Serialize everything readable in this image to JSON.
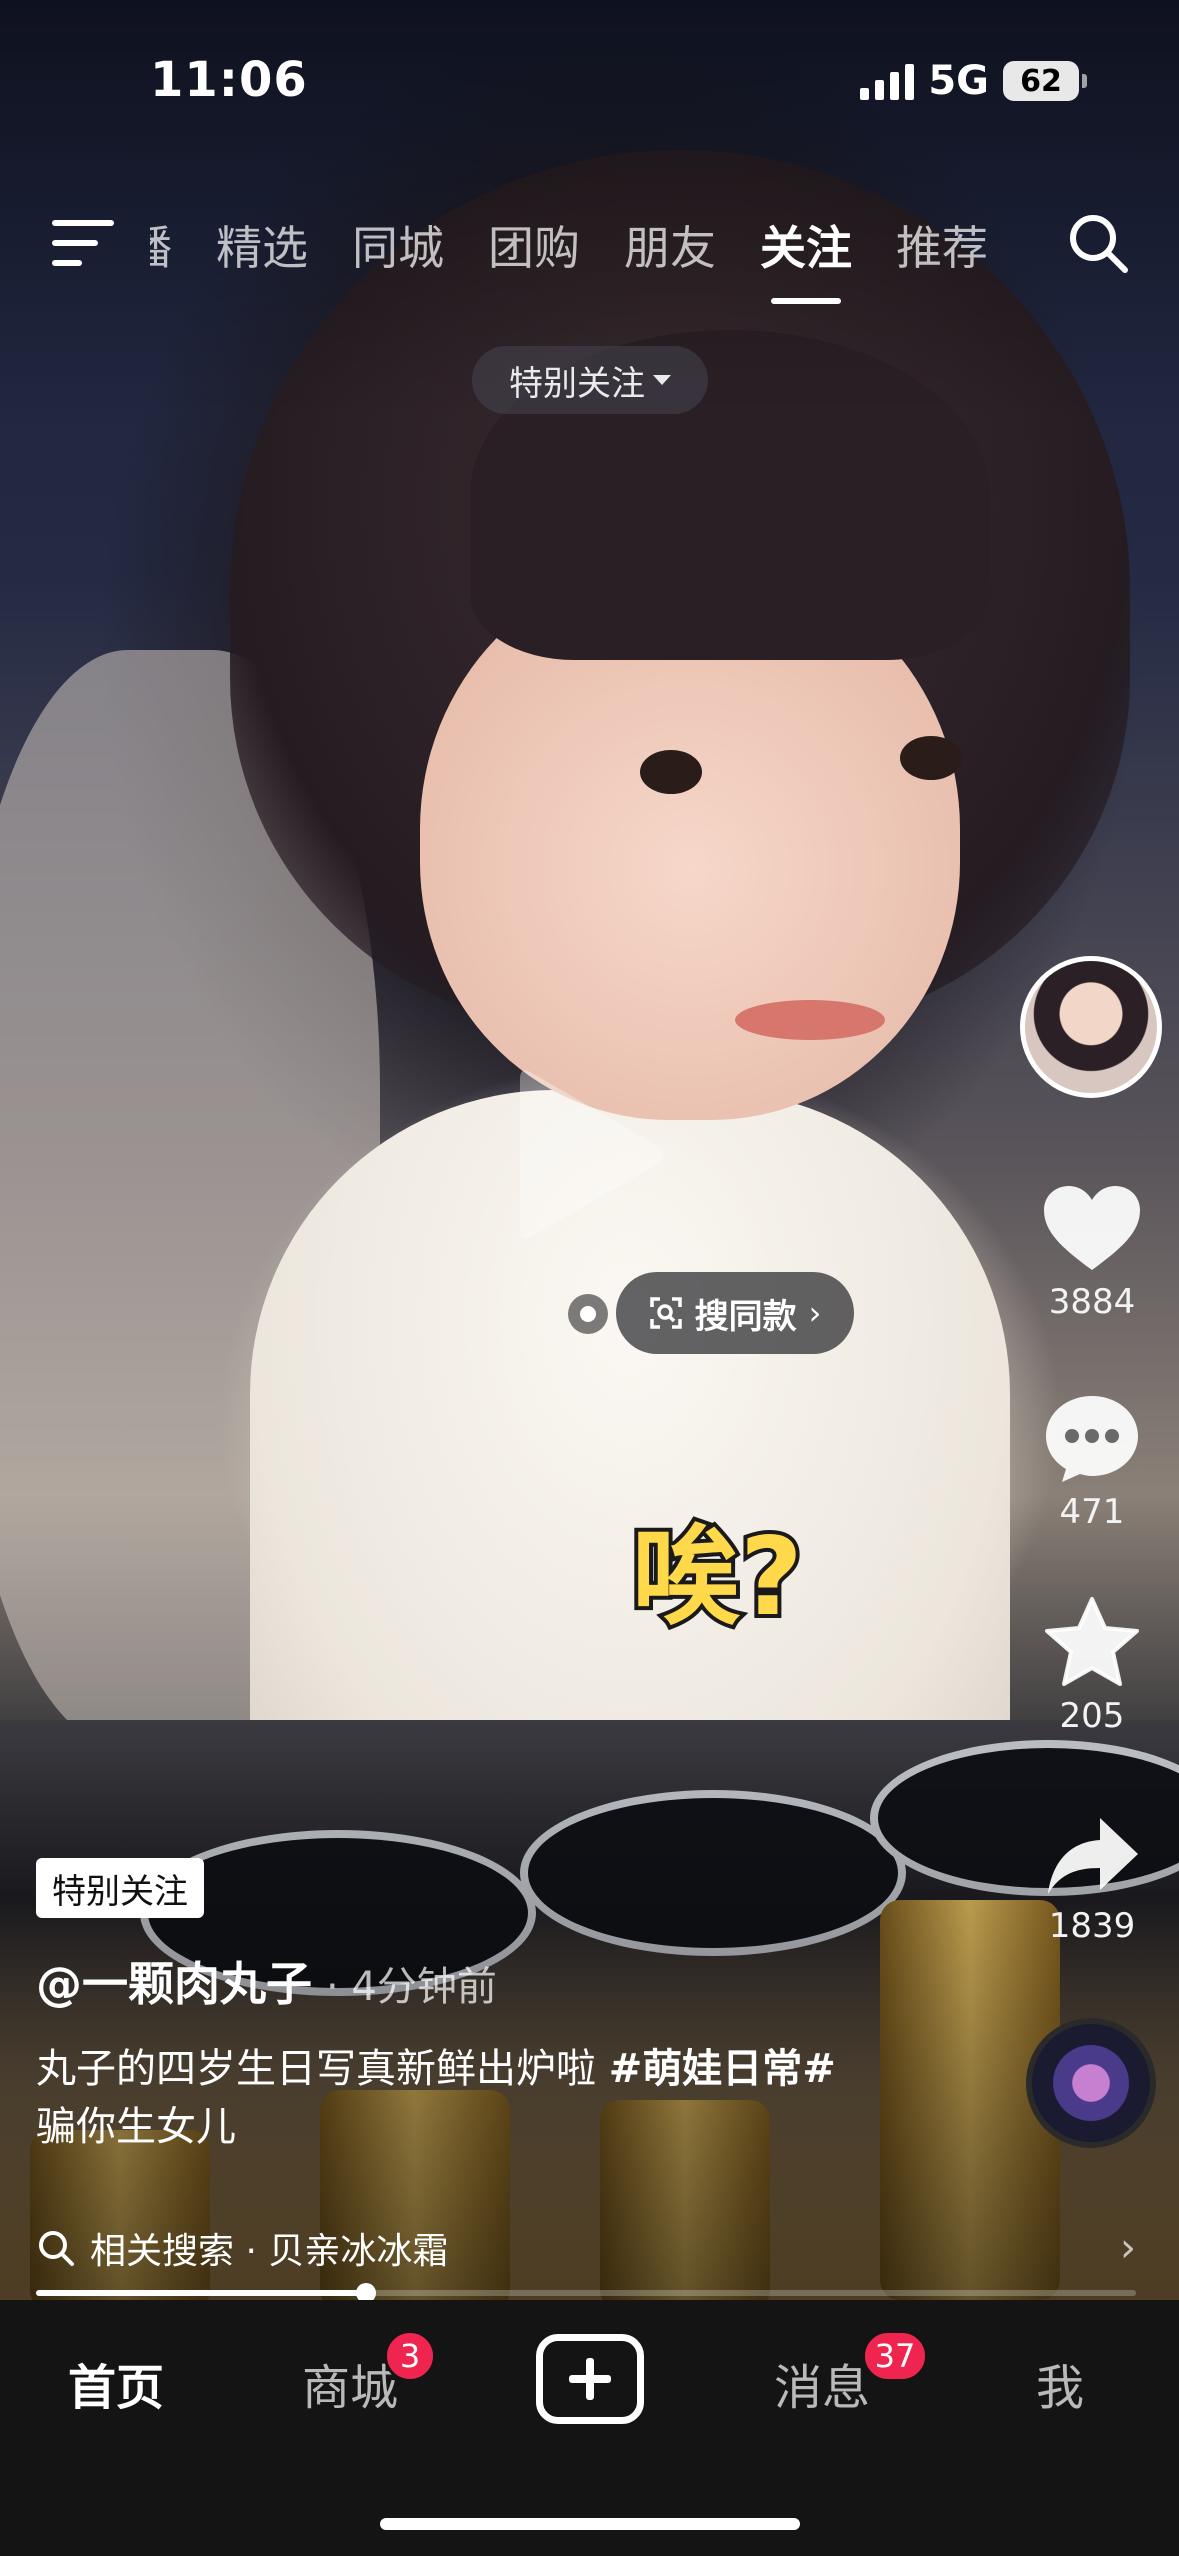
{
  "status_bar": {
    "time": "11:06",
    "network": "5G",
    "battery": "62"
  },
  "top_nav": {
    "tabs": [
      {
        "label": "播",
        "active": false
      },
      {
        "label": "精选",
        "active": false
      },
      {
        "label": "同城",
        "active": false
      },
      {
        "label": "团购",
        "active": false
      },
      {
        "label": "朋友",
        "active": false
      },
      {
        "label": "关注",
        "active": true
      },
      {
        "label": "推荐",
        "active": false
      }
    ],
    "special_follow_pill": "特别关注"
  },
  "video_overlay": {
    "search_same_label": "搜同款",
    "sticker_text": "唉?"
  },
  "right_rail": {
    "like_count": "3884",
    "comment_count": "471",
    "favorite_count": "205",
    "share_count": "1839"
  },
  "caption": {
    "tag": "特别关注",
    "author": "@一颗肉丸子",
    "time_ago": "· 4分钟前",
    "text": "丸子的四岁生日写真新鲜出炉啦 ",
    "hashtag": "#萌娃日常#",
    "text_line2": "骗你生女儿"
  },
  "related_search": {
    "label": "相关搜索 · 贝亲冰冰霜"
  },
  "playback": {
    "progress": 0.3
  },
  "bottom_nav": {
    "home": "首页",
    "mall": "商城",
    "mall_badge": "3",
    "messages": "消息",
    "messages_badge": "37",
    "me": "我"
  },
  "colors": {
    "badge": "#f0254f",
    "sticker": "#ffd94a",
    "bottom_bar": "#141414"
  }
}
